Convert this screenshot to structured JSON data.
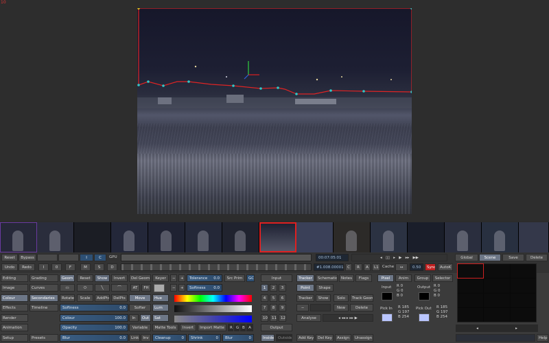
{
  "corner_mark": "10",
  "timeline": {
    "reset": "Reset",
    "bypass": "Bypass",
    "i": "I",
    "c": "C",
    "gpu": "GPU",
    "undo": "Undo",
    "redo": "Redo",
    "k1": "I",
    "k2": "0",
    "k3": "F",
    "k4": "M",
    "k5": "S",
    "k6": "D",
    "timecode": "00:07:05:01",
    "frame_id": "#1.008.00001",
    "c_btn": "C",
    "r_btn": "R",
    "a_btn": "A",
    "l1_btn": "L1",
    "cache": "Cache",
    "speed": "0.50",
    "sync": "Sync",
    "autok": "AutoK",
    "global": "Global",
    "scene": "Scene",
    "save": "Save",
    "delete": "Delete"
  },
  "left_menu": {
    "col1": [
      "Editing",
      "Image",
      "Colour",
      "Effects",
      "Render",
      "Animation",
      "Setup"
    ],
    "col2": [
      "Grading",
      "Curves",
      "Secondaries",
      "Timeline",
      "",
      "",
      "Presets"
    ]
  },
  "geom": {
    "geom": "Geom",
    "reset": "Reset",
    "show": "Show",
    "invert": "Invert",
    "del_geom": "Del Geom",
    "rotate": "Rotate",
    "scale": "Scale",
    "add_pts": "AddPts",
    "del_pts": "DelPts",
    "move": "Move"
  },
  "sliders": {
    "softness": {
      "label": "Softness",
      "value": "0.0"
    },
    "colour": {
      "label": "Colour",
      "value": "100.0"
    },
    "opacity": {
      "label": "Opacity",
      "value": "100.0"
    },
    "blur": {
      "label": "Blur",
      "value": "0.0"
    }
  },
  "keyer": {
    "keyer": "Keyer",
    "at": "AT",
    "fh": "FH",
    "softer": "Softer",
    "in": "In",
    "out": "Out",
    "variable": "Variable",
    "link": "Link",
    "inv": "Inv",
    "hue": "Hue",
    "lum": "Lum",
    "sat": "Sat",
    "tolerance_label": "Tolerance",
    "tolerance_value": "0.0",
    "softness_label": "Softness",
    "softness_value": "0.0",
    "src_prim": "Src Prim",
    "gc": "GC",
    "matte_tools": "Matte Tools",
    "invert": "Invert",
    "import_matte": "Import Matte",
    "cleanup_label": "Cleanup",
    "cleanup_value": "0",
    "shrink_label": "Shrink",
    "shrink_value": "0",
    "blur_label": "Blur",
    "blur_value": "0",
    "matte_letters": [
      "R",
      "G",
      "B",
      "A"
    ]
  },
  "io": {
    "input": "Input",
    "output": "Output",
    "inside": "Inside",
    "outside": "Outside",
    "keypad": [
      "1",
      "2",
      "3",
      "4",
      "5",
      "6",
      "7",
      "8",
      "9",
      "10",
      "11",
      "12"
    ]
  },
  "tracker": {
    "tracker": "Tracker",
    "schematic": "Schematic",
    "notes": "Notes",
    "flags": "Flags",
    "point": "Point",
    "shape": "Shape",
    "tracker2": "Tracker",
    "show": "Show",
    "solo": "Solo",
    "track_geom": "Track Geom",
    "minus": "−",
    "new": "New",
    "delete": "Delete",
    "analyse": "Analyse",
    "add_key": "Add Key",
    "del_key": "Del Key",
    "assign": "Assign",
    "unassign": "Unassign"
  },
  "pixel": {
    "pixel": "Pixel",
    "anim": "Anim",
    "group": "Group",
    "selector": "Selector",
    "input": "Input",
    "output": "Output",
    "in_rgb": [
      "R  0",
      "G  0",
      "B  0"
    ],
    "out_rgb": [
      "R  0",
      "G  0",
      "B  0"
    ],
    "pick_in": "Pick In",
    "pick_out": "Pick Out",
    "pick_in_rgb": [
      "R  185",
      "G  197",
      "B  254"
    ],
    "pick_out_rgb": [
      "R  185",
      "G  197",
      "B  254"
    ],
    "help": "Help"
  },
  "colors": {
    "accent": "#e02020",
    "blue": "#2d4f73",
    "panel": "#3b3b3b"
  }
}
